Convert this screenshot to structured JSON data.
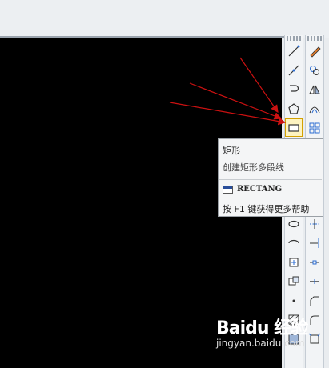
{
  "tooltip": {
    "title": "矩形",
    "description": "创建矩形多段线",
    "command": "RECTANG",
    "help": "按 F1 键获得更多帮助"
  },
  "toolbars": {
    "draw": [
      "line-icon",
      "construction-line-icon",
      "polyline-icon",
      "polygon-icon",
      "rectangle-icon",
      "arc-icon",
      "circle-icon",
      "revision-cloud-icon",
      "spline-icon",
      "ellipse-icon",
      "ellipse-arc-icon",
      "insert-block-icon",
      "make-block-icon",
      "point-icon",
      "hatch-icon",
      "gradient-icon"
    ],
    "modify": [
      "erase-icon",
      "copy-icon",
      "mirror-icon",
      "offset-icon",
      "array-icon",
      "move-icon",
      "rotate-icon",
      "scale-icon",
      "stretch-icon",
      "trim-icon",
      "extend-icon",
      "break-icon",
      "join-icon",
      "chamfer-icon",
      "fillet-icon",
      "explode-icon"
    ]
  },
  "watermark": {
    "logo": "Baidu 经验",
    "url": "jingyan.baidu.com"
  },
  "colors": {
    "canvas": "#000000",
    "arrow": "#cc1111",
    "selected": "#fdf3c0"
  }
}
